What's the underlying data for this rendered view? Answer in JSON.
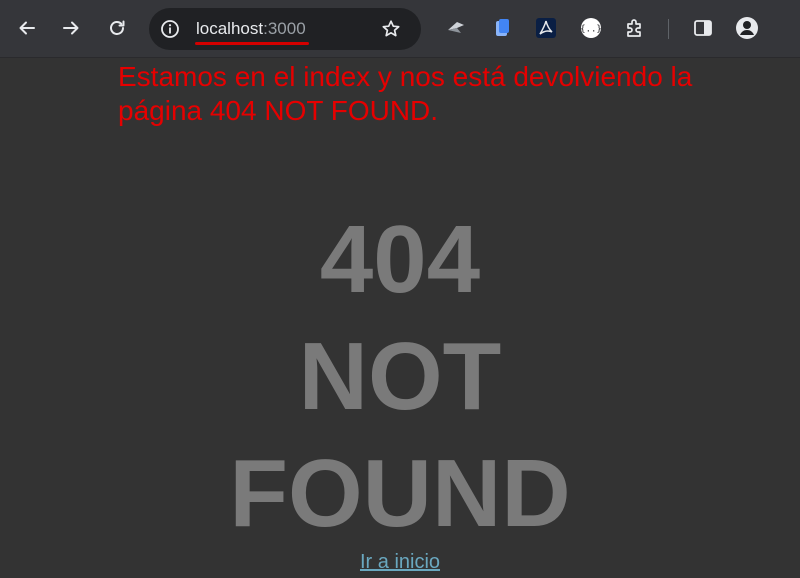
{
  "browser": {
    "url_host": "localhost",
    "url_port": ":3000",
    "icons": {
      "back": "arrow-left-icon",
      "forward": "arrow-right-icon",
      "reload": "reload-icon",
      "info": "info-icon",
      "bookmark": "star-icon",
      "ext1": "vpn-extension-icon",
      "ext2": "docs-extension-icon",
      "ext3": "pdf-extension-icon",
      "ext4": "json-extension-icon",
      "extensions": "puzzle-icon",
      "sidepanel": "side-panel-icon",
      "profile": "profile-icon"
    }
  },
  "annotation": {
    "text": "Estamos en el index y nos está devolviendo  la página 404 NOT FOUND.",
    "color": "#e60000"
  },
  "error_page": {
    "line1": "404",
    "line2": "NOT",
    "line3": "FOUND",
    "link_label": "Ir a inicio"
  },
  "colors": {
    "page_bg": "#333333",
    "error_text": "#7a7a7a",
    "link": "#6aa8c0"
  }
}
